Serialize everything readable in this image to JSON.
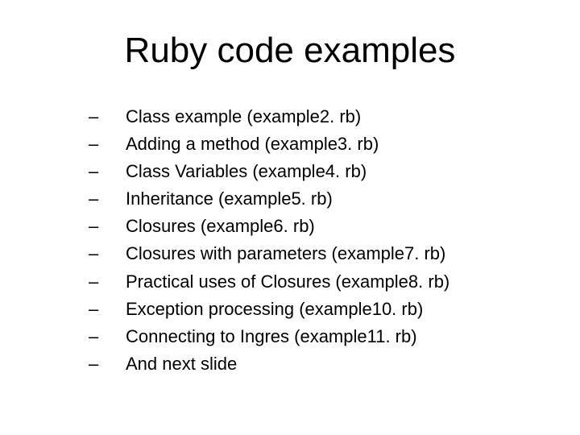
{
  "title": "Ruby code examples",
  "bullet": "–",
  "items": [
    "Class example (example2. rb)",
    "Adding a method (example3. rb)",
    "Class Variables (example4. rb)",
    "Inheritance (example5. rb)",
    "Closures (example6. rb)",
    "Closures with parameters (example7. rb)",
    "Practical uses of Closures (example8. rb)",
    "Exception processing (example10. rb)",
    "Connecting to Ingres (example11. rb)",
    "And next slide"
  ]
}
